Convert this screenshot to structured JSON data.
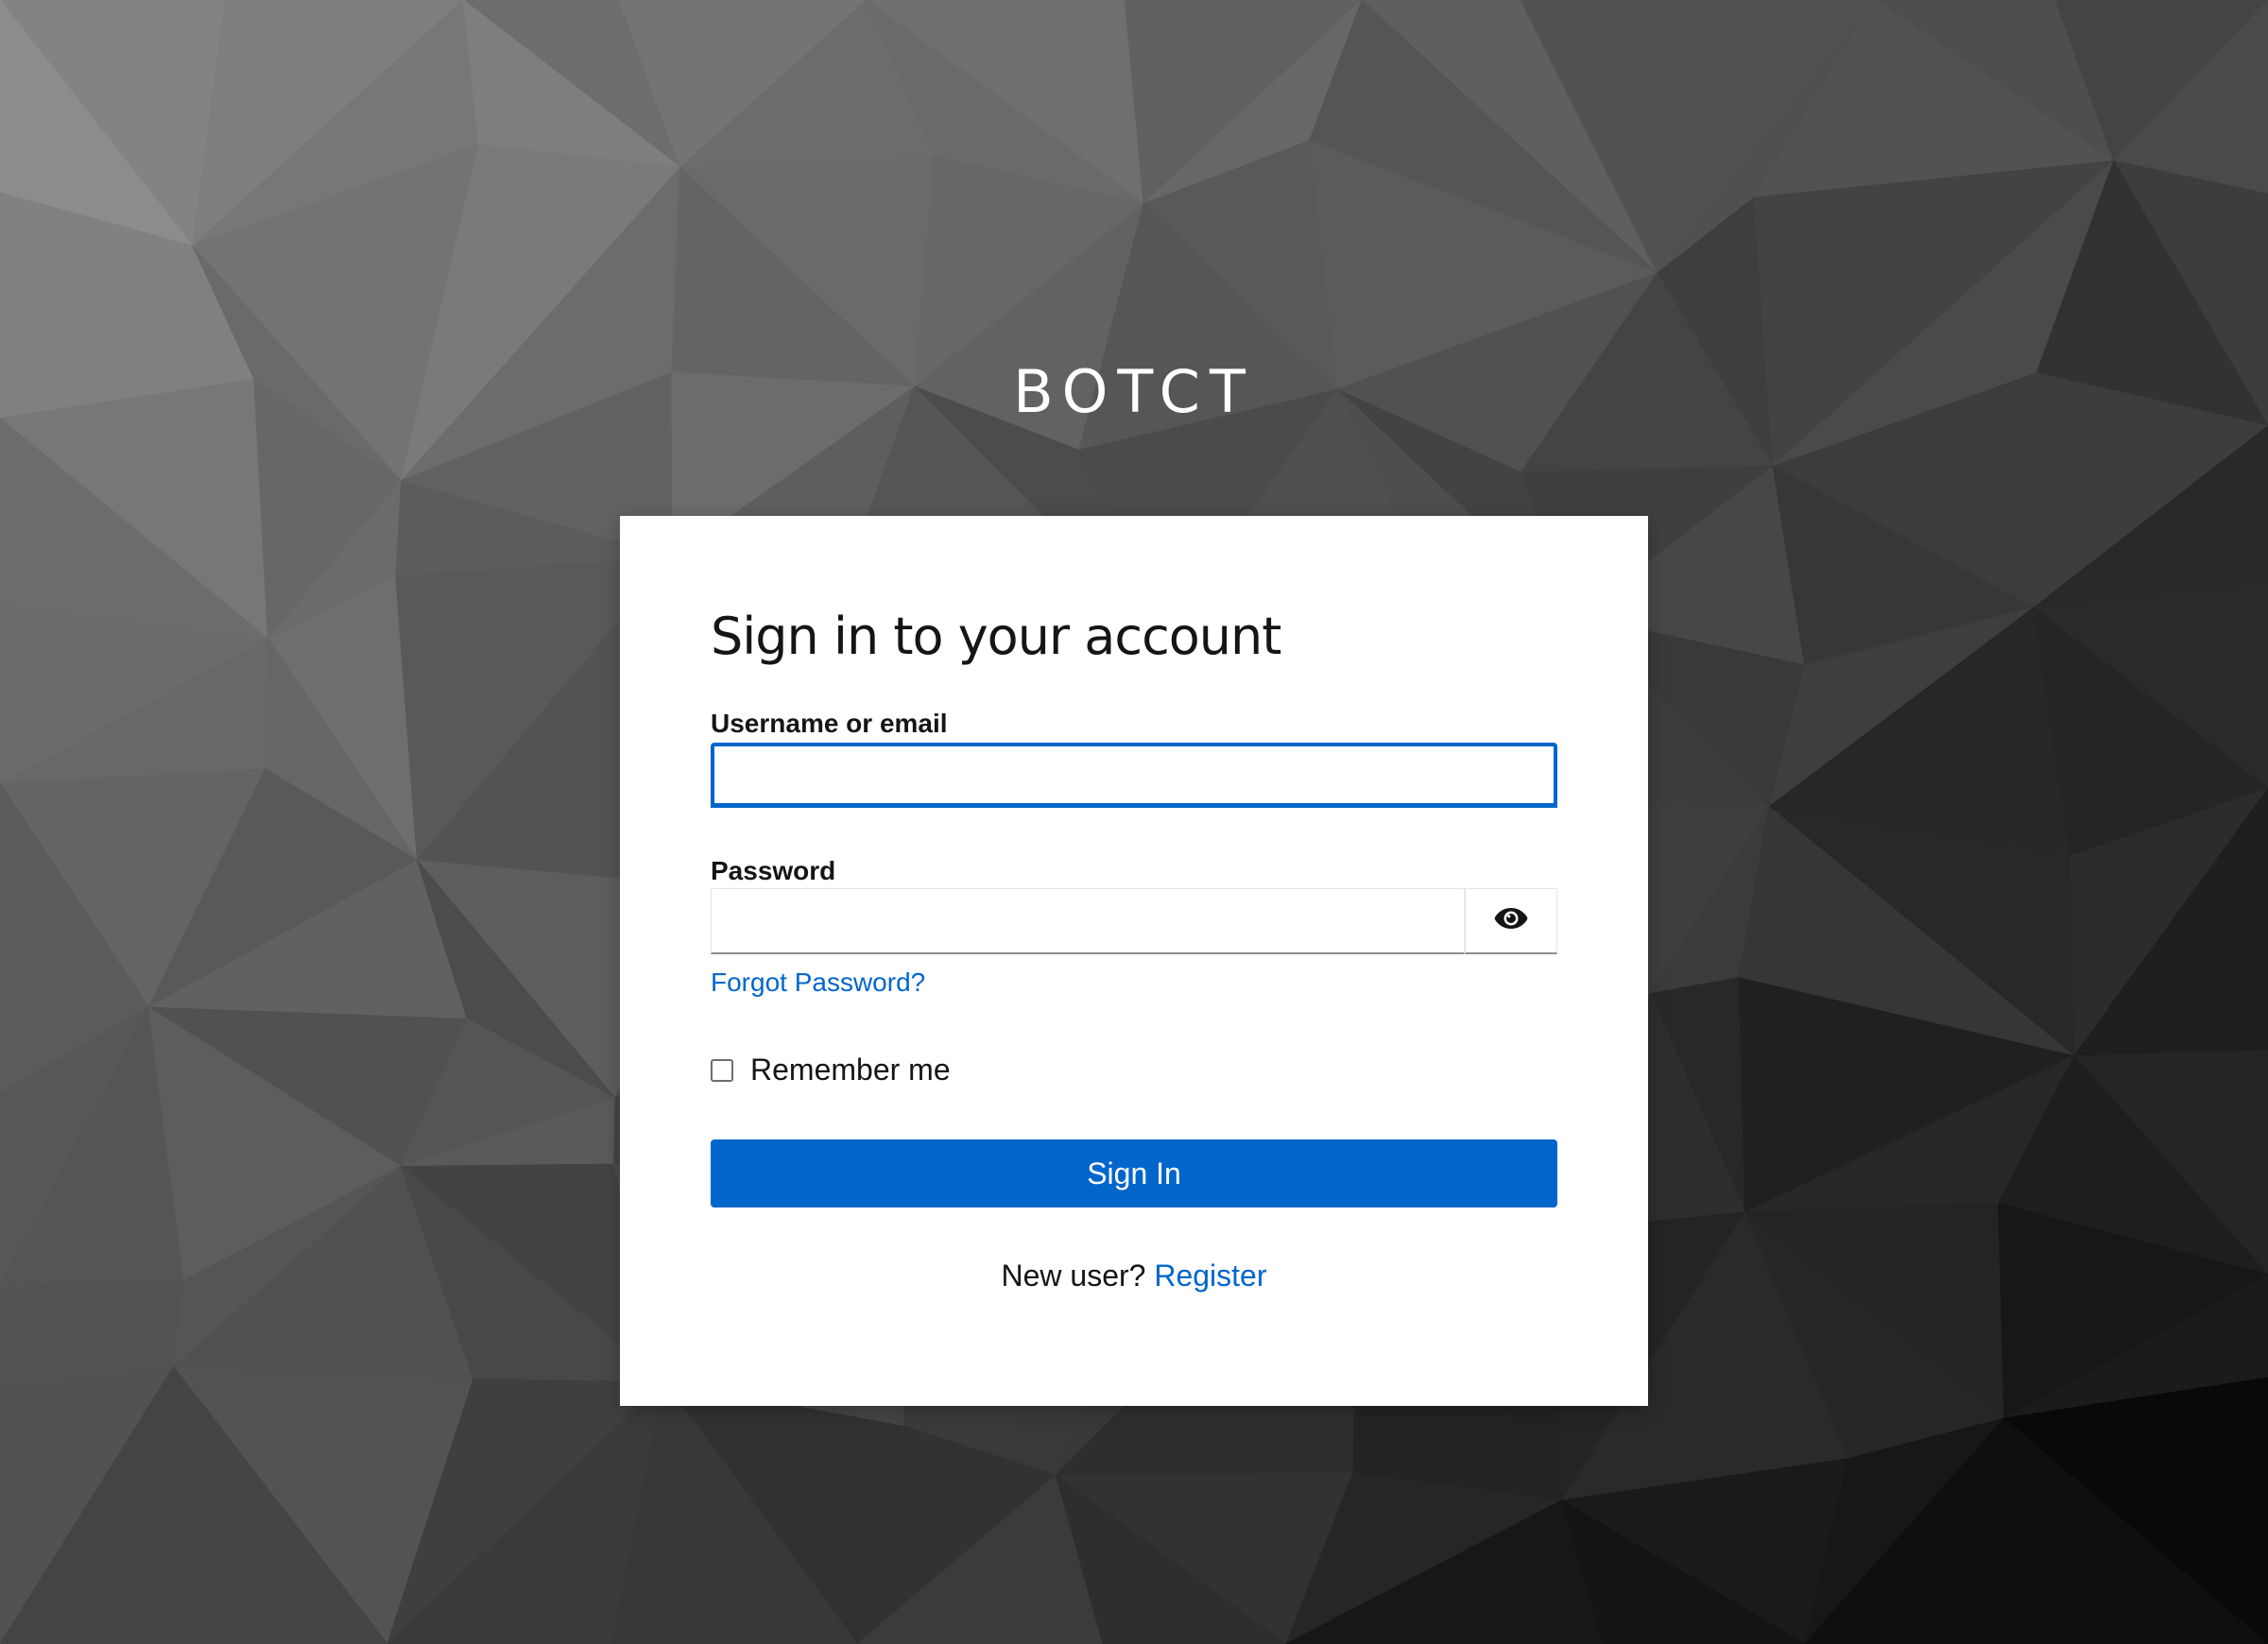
{
  "brand": {
    "name": "BOTCT"
  },
  "login": {
    "title": "Sign in to your account",
    "username_label": "Username or email",
    "username_value": "",
    "password_label": "Password",
    "password_value": "",
    "show_password_icon": "eye-icon",
    "forgot_password": "Forgot Password?",
    "remember_me": "Remember me",
    "remember_checked": false,
    "submit_label": "Sign In",
    "new_user_text": "New user?",
    "register_link": "Register"
  },
  "colors": {
    "accent": "#0066cc",
    "card_background": "#ffffff",
    "text": "#151515",
    "background_light": "#8a8a8a",
    "background_dark": "#0a0a0a"
  }
}
